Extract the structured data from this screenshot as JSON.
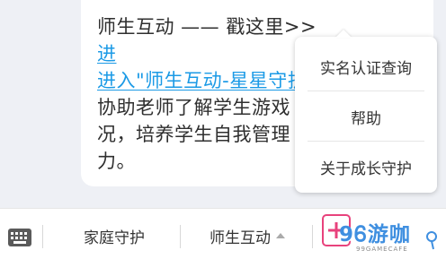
{
  "message": {
    "line1_prefix": "师生互动 —— 戳这里>>",
    "link_text": "进入\"师生互动-星星守护",
    "line3": "协助老师了解学生游戏",
    "line4": "况，培养学生自我管理",
    "line5": "力。"
  },
  "popup_menu": {
    "items": [
      {
        "label": "实名认证查询"
      },
      {
        "label": "帮助"
      },
      {
        "label": "关于成长守护"
      }
    ]
  },
  "bottom_bar": {
    "keyboard_icon": "keyboard-icon",
    "tabs": [
      {
        "label": "家庭守护"
      },
      {
        "label": "师生互动"
      }
    ]
  },
  "watermark": {
    "text": "9Ꮾ游咖",
    "subtext": "99GAMECAFE"
  },
  "colors": {
    "background": "#eef0f5",
    "link": "#1b9ae6",
    "watermark": "#3f8fe0",
    "watermark_accent": "#e8427c"
  }
}
